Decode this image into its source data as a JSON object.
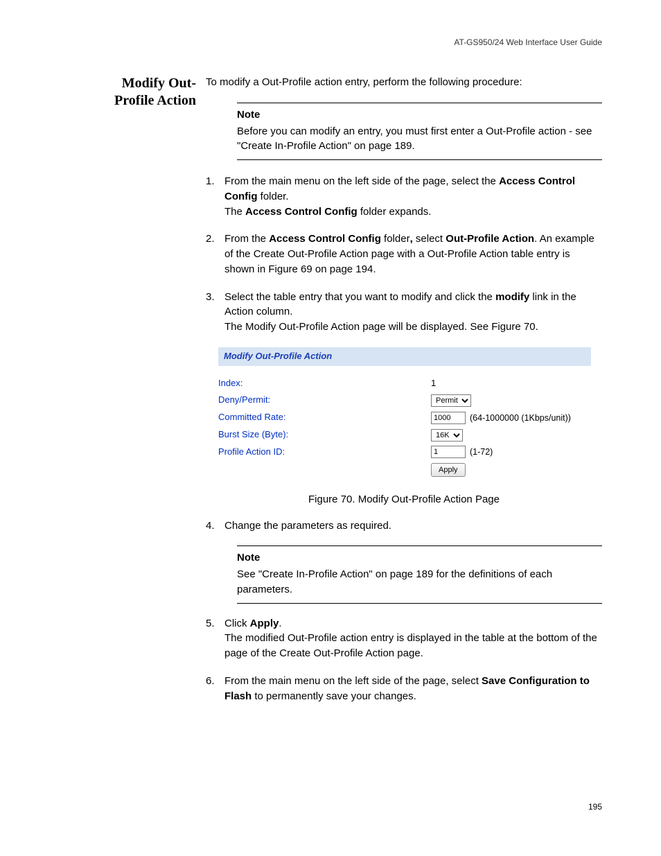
{
  "header": {
    "doc_title": "AT-GS950/24  Web Interface User Guide"
  },
  "section": {
    "heading_line1": "Modify Out-",
    "heading_line2": "Profile Action",
    "intro": "To modify a Out-Profile action entry, perform the following procedure:"
  },
  "note1": {
    "title": "Note",
    "body": "Before you can modify an entry, you must first enter a Out-Profile action - see \"Create In-Profile Action\" on page 189."
  },
  "steps": {
    "s1_a": "From the main menu on the left side of the page, select the ",
    "s1_b_bold": "Access Control Config",
    "s1_c": " folder.",
    "s1_d": "The ",
    "s1_e_bold": "Access Control Config",
    "s1_f": " folder expands.",
    "s2_a": "From the ",
    "s2_b_bold": "Access Control Config",
    "s2_c": " folder",
    "s2_comma_bold": ",",
    "s2_d": " select ",
    "s2_e_bold": "Out-Profile Action",
    "s2_f": ". An example of the Create Out-Profile Action page with a Out-Profile Action table entry is shown in Figure 69 on page 194.",
    "s3_a": "Select the table entry that you want to modify and click the ",
    "s3_b_bold": "modify",
    "s3_c": " link in the Action column.",
    "s3_d": "The Modify Out-Profile Action page will be displayed. See Figure 70.",
    "s4": "Change the parameters as required.",
    "s5_a": "Click ",
    "s5_b_bold": "Apply",
    "s5_c": ".",
    "s5_d": "The modified Out-Profile action entry is displayed in the table at the bottom of the page of the Create Out-Profile Action page.",
    "s6_a": "From the main menu on the left side of the page, select ",
    "s6_b_bold": "Save Configuration to Flash",
    "s6_c": " to permanently save your changes."
  },
  "figure": {
    "title": "Modify Out-Profile Action",
    "labels": {
      "index": "Index:",
      "deny_permit": "Deny/Permit:",
      "committed_rate": "Committed Rate:",
      "burst_size": "Burst Size (Byte):",
      "profile_action_id": "Profile Action ID:"
    },
    "values": {
      "index": "1",
      "deny_permit_selected": "Permit",
      "committed_rate": "1000",
      "committed_rate_hint": "(64-1000000 (1Kbps/unit))",
      "burst_size_selected": "16K",
      "profile_action_id": "1",
      "profile_action_hint": "(1-72)"
    },
    "apply_label": "Apply",
    "caption": "Figure 70. Modify Out-Profile Action Page"
  },
  "note2": {
    "title": "Note",
    "body": "See \"Create In-Profile Action\" on page 189 for the definitions of each parameters."
  },
  "page_number": "195"
}
